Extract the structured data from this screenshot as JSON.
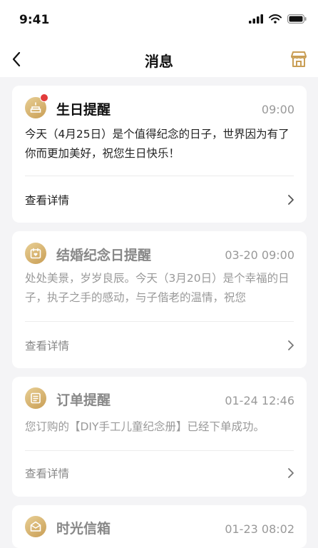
{
  "status_bar": {
    "time": "9:41"
  },
  "nav": {
    "title": "消息"
  },
  "colors": {
    "gold": "#c99e55",
    "unread_dot": "#e23b3b",
    "background": "#f4f4f6"
  },
  "messages": [
    {
      "title": "生日提醒",
      "time": "09:00",
      "body": "今天（4月25日）是个值得纪念的日子，世界因为有了你而更加美好，祝您生日快乐！",
      "link": "查看详情",
      "unread": true,
      "icon": "cake-icon"
    },
    {
      "title": "结婚纪念日提醒",
      "time": "03-20 09:00",
      "body": "处处美景，岁岁良辰。今天（3月20日）是个幸福的日子，执子之手的感动，与子偕老的温情，祝您",
      "link": "查看详情",
      "unread": false,
      "icon": "calendar-heart-icon"
    },
    {
      "title": "订单提醒",
      "time": "01-24 12:46",
      "body": "您订购的【DIY手工儿童纪念册】已经下单成功。",
      "link": "查看详情",
      "unread": false,
      "icon": "order-list-icon"
    },
    {
      "title": "时光信箱",
      "time": "01-23 08:02",
      "unread": false,
      "icon": "envelope-heart-icon"
    }
  ]
}
